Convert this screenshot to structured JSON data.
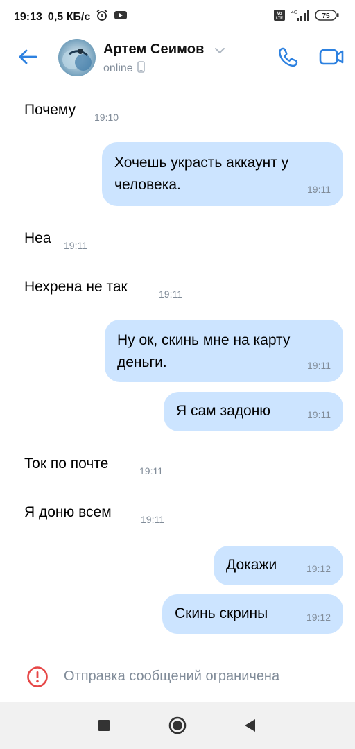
{
  "status_bar": {
    "time": "19:13",
    "net_speed": "0,5 КБ/с",
    "signal": "4G",
    "battery": "75",
    "icons": [
      "alarm-icon",
      "youtube-icon",
      "volte-icon",
      "signal-icon",
      "battery-icon"
    ]
  },
  "header": {
    "contact_name": "Артем Сеимов",
    "status": "online",
    "icons": [
      "back-arrow-icon",
      "chevron-down-icon",
      "phone-device-icon",
      "call-icon",
      "video-call-icon"
    ]
  },
  "messages": [
    {
      "dir": "in",
      "text": "Почему",
      "time": "19:10"
    },
    {
      "dir": "out",
      "line1": "Хочешь украсть аккаунт у",
      "line2": "человека.",
      "time": "19:11"
    },
    {
      "dir": "in",
      "text": "Неа",
      "time": "19:11"
    },
    {
      "dir": "in",
      "text": "Нехрена не так",
      "time": "19:11"
    },
    {
      "dir": "out",
      "line1": "Ну ок, скинь мне на карту",
      "line2": "деньги.",
      "time": "19:11"
    },
    {
      "dir": "out",
      "text": "Я сам задоню",
      "time": "19:11"
    },
    {
      "dir": "in",
      "text": "Ток по почте",
      "time": "19:11"
    },
    {
      "dir": "in",
      "text": "Я доню всем",
      "time": "19:11"
    },
    {
      "dir": "out",
      "text": "Докажи",
      "time": "19:12"
    },
    {
      "dir": "out",
      "text": "Скинь скрины",
      "time": "19:12"
    }
  ],
  "footer": {
    "restriction_text": "Отправка сообщений ограничена",
    "icon": "warning-circle-icon"
  },
  "navbar": {
    "icons": [
      "recents-square-icon",
      "home-circle-icon",
      "back-triangle-icon"
    ]
  },
  "colors": {
    "accent": "#2d81e0",
    "outgoing_bubble": "#cce4ff",
    "secondary_text": "#818c99",
    "warning": "#e64646"
  }
}
